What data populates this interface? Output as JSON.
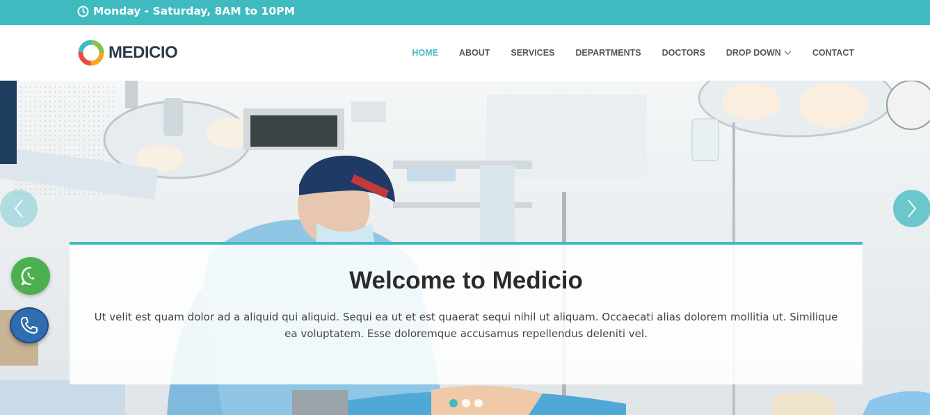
{
  "topbar": {
    "hours": "Monday - Saturday, 8AM to 10PM",
    "icon": "clock-icon"
  },
  "header": {
    "logo_text": "MEDICIO",
    "nav": [
      {
        "label": "HOME",
        "active": true
      },
      {
        "label": "ABOUT",
        "active": false
      },
      {
        "label": "SERVICES",
        "active": false
      },
      {
        "label": "DEPARTMENTS",
        "active": false
      },
      {
        "label": "DOCTORS",
        "active": false
      },
      {
        "label": "DROP DOWN",
        "active": false,
        "has_dropdown": true
      },
      {
        "label": "CONTACT",
        "active": false
      }
    ]
  },
  "hero": {
    "title": "Welcome to Medicio",
    "text": "Ut velit est quam dolor ad a aliquid qui aliquid. Sequi ea ut et est quaerat sequi nihil ut aliquam. Occaecati alias dolorem mollitia ut. Similique ea voluptatem. Esse doloremque accusamus repellendus deleniti vel.",
    "slide_count": 3,
    "active_slide": 1
  },
  "floating": {
    "whatsapp_icon": "whatsapp-icon",
    "phone_icon": "phone-icon"
  },
  "colors": {
    "accent": "#3fbbc0",
    "whatsapp": "#4caf50",
    "phone": "#2f6db0"
  }
}
